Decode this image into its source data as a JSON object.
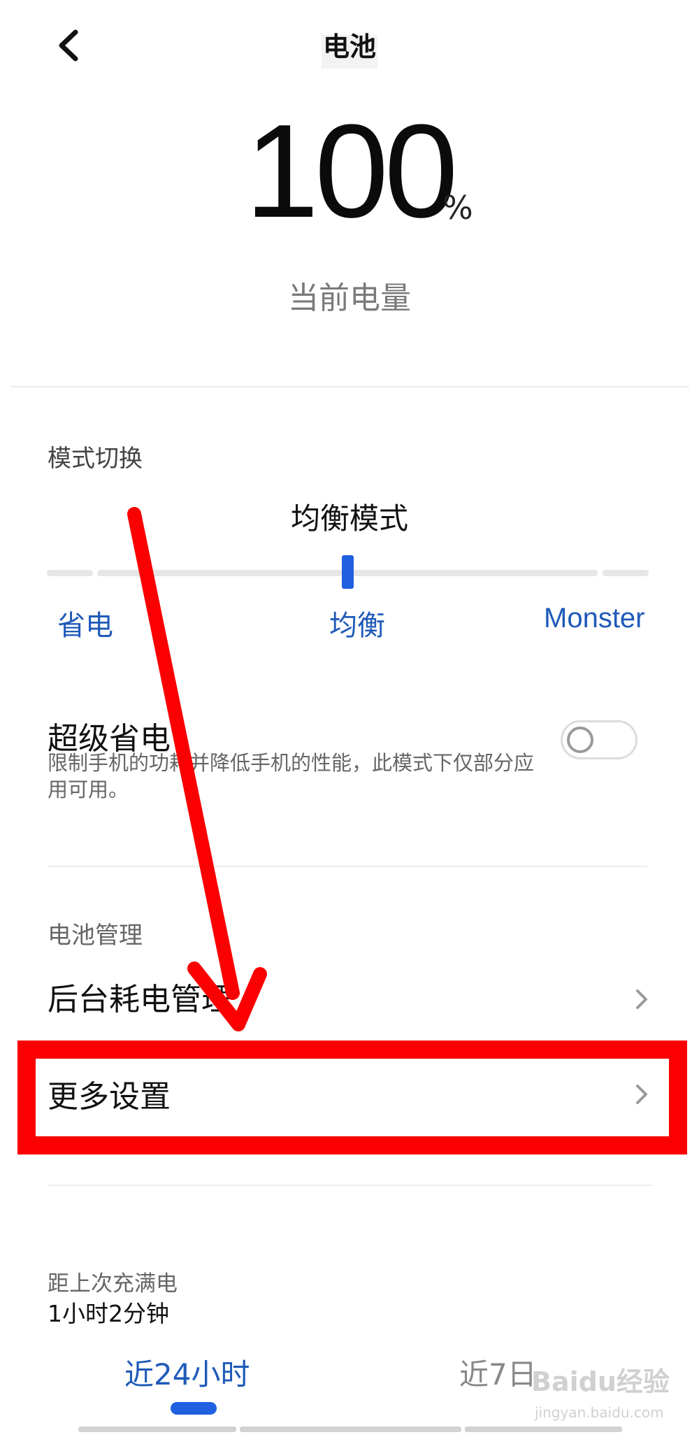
{
  "header": {
    "title": "电池",
    "back_icon": "chevron-left-icon"
  },
  "battery": {
    "value": "100",
    "unit": "%",
    "caption": "当前电量"
  },
  "mode": {
    "section_title": "模式切换",
    "current_mode": "均衡模式",
    "options": [
      "省电",
      "均衡",
      "Monster"
    ],
    "selected_option": "均衡"
  },
  "super_saving": {
    "title": "超级省电",
    "description": "限制手机的功耗并降低手机的性能，此模式下仅部分应用可用。",
    "enabled": false
  },
  "management": {
    "section_title": "电池管理",
    "items": [
      {
        "label": "后台耗电管理",
        "icon": "chevron-right-icon"
      },
      {
        "label": "更多设置",
        "icon": "chevron-right-icon"
      }
    ]
  },
  "stats": {
    "since_full_label": "距上次充满电",
    "since_full_value": "1小时2分钟",
    "tabs": [
      "近24小时",
      "近7日"
    ],
    "active_tab": "近24小时"
  },
  "annotation": {
    "highlight_color": "#fa0000",
    "arrow_color": "#fa0000"
  },
  "colors": {
    "accent": "#1f5fe0",
    "accent_text": "#1f5ab8"
  },
  "watermark": {
    "text": "Baidu经验",
    "subtext": "jingyan.baidu.com"
  }
}
